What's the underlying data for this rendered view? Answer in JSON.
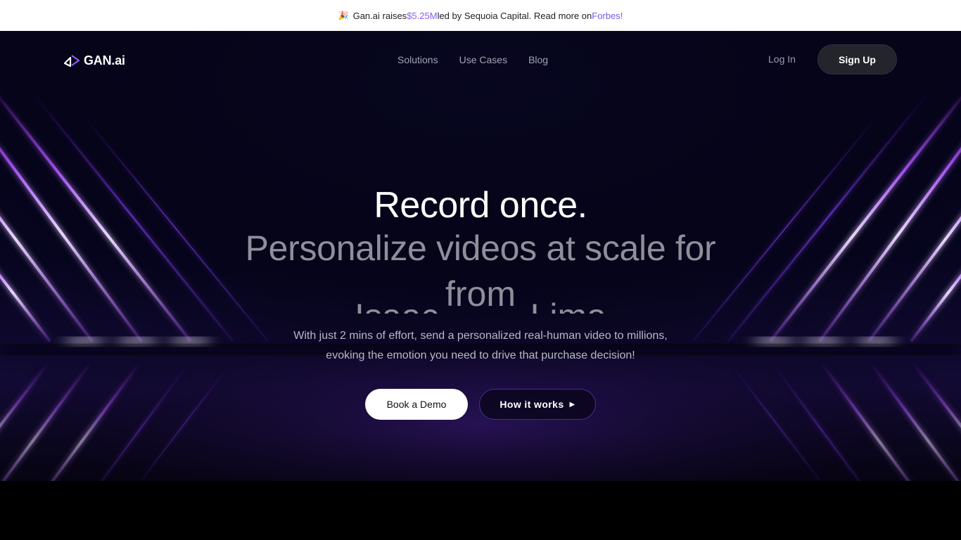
{
  "announcement": {
    "icon": "party-popper-icon",
    "prefix": "Gan.ai raises ",
    "amount": "$5.25M",
    "middle": " led by Sequoia Capital. Read more on ",
    "link": "Forbes!"
  },
  "nav": {
    "logo_text": "GAN.ai",
    "links": [
      "Solutions",
      "Use Cases",
      "Blog"
    ],
    "login": "Log In",
    "signup": "Sign Up"
  },
  "hero": {
    "headline": "Record once.",
    "subhead": "Personalize videos at scale for",
    "rotator_from": "from",
    "rotator_names": [
      "Isaac",
      "Lima"
    ],
    "description_line1": "With just 2 mins of effort, send a personalized real-human video to millions,",
    "description_line2": "evoking the emotion you need to drive that purchase decision!",
    "cta_primary": "Book a Demo",
    "cta_secondary": "How it works",
    "cta_secondary_icon": "caret-right-icon"
  },
  "colors": {
    "accent": "#8b5cf6",
    "beam_purple": "#a855f7",
    "background": "#05041a"
  }
}
